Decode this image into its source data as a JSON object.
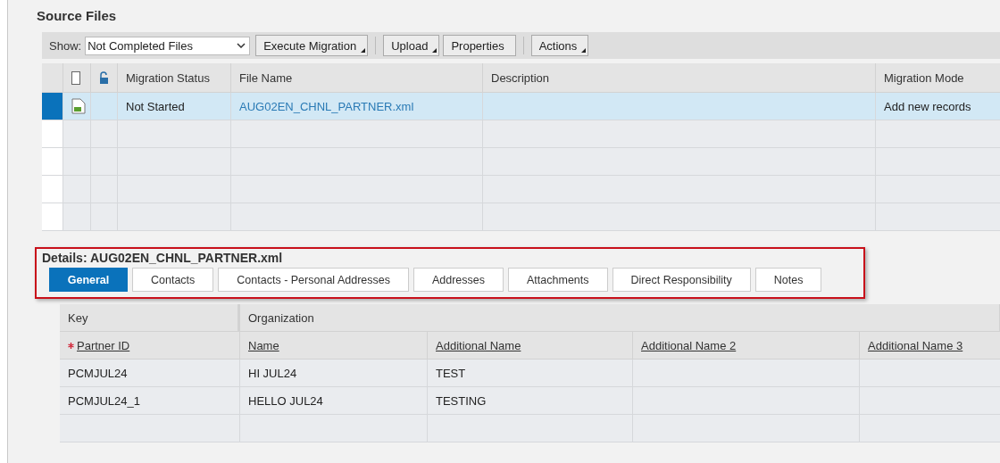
{
  "section_title": "Source Files",
  "toolbar": {
    "show_label": "Show:",
    "show_value": "Not Completed Files",
    "buttons": [
      {
        "label": "Execute Migration",
        "menu": true
      },
      {
        "label": "Upload",
        "menu": true
      },
      {
        "label": "Properties",
        "menu": false
      },
      {
        "label": "Actions",
        "menu": true
      }
    ]
  },
  "files_table": {
    "select_all_checked": false,
    "columns": [
      "Migration Status",
      "File Name",
      "Description",
      "Migration Mode"
    ],
    "rows": [
      {
        "selected": true,
        "migration_status": "Not Started",
        "file_name": "AUG02EN_CHNL_PARTNER.xml",
        "migration_mode": "Add new records"
      }
    ]
  },
  "details": {
    "title": "Details: AUG02EN_CHNL_PARTNER.xml",
    "tabs": [
      {
        "label": "General",
        "selected": true
      },
      {
        "label": "Contacts",
        "selected": false
      },
      {
        "label": "Contacts - Personal Addresses",
        "selected": false
      },
      {
        "label": "Addresses",
        "selected": false
      },
      {
        "label": "Attachments",
        "selected": false
      },
      {
        "label": "Direct Responsibility",
        "selected": false
      },
      {
        "label": "Notes",
        "selected": false
      }
    ],
    "groups": [
      "Key",
      "Organization"
    ],
    "columns": [
      {
        "label": "Partner ID",
        "required": true
      },
      {
        "label": "Name",
        "required": false
      },
      {
        "label": "Additional Name",
        "required": false
      },
      {
        "label": "Additional Name 2",
        "required": false
      },
      {
        "label": "Additional Name 3",
        "required": false
      }
    ],
    "rows": [
      [
        "PCMJUL24",
        "HI JUL24",
        "TEST"
      ],
      [
        "PCMJUL24_1",
        "HELLO JUL24",
        "TESTING"
      ]
    ]
  }
}
